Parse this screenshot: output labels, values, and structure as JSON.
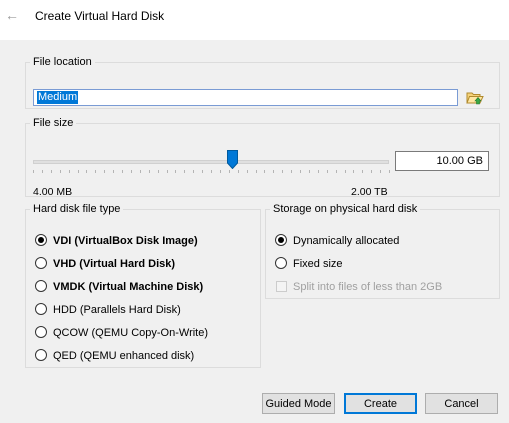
{
  "dialog": {
    "title": "Create Virtual Hard Disk"
  },
  "file_location": {
    "legend": "File location",
    "value": "Medium"
  },
  "file_size": {
    "legend": "File size",
    "value": "10.00 GB",
    "min_label": "4.00 MB",
    "max_label": "2.00 TB",
    "slider_fraction": 0.56
  },
  "disk_type": {
    "legend": "Hard disk file type",
    "options": [
      {
        "label": "VDI (VirtualBox Disk Image)",
        "selected": true
      },
      {
        "label": "VHD (Virtual Hard Disk)",
        "selected": false
      },
      {
        "label": "VMDK (Virtual Machine Disk)",
        "selected": false
      },
      {
        "label": "HDD (Parallels Hard Disk)",
        "selected": false
      },
      {
        "label": "QCOW (QEMU Copy-On-Write)",
        "selected": false
      },
      {
        "label": "QED (QEMU enhanced disk)",
        "selected": false
      }
    ]
  },
  "storage": {
    "legend": "Storage on physical hard disk",
    "options": [
      {
        "label": "Dynamically allocated",
        "selected": true
      },
      {
        "label": "Fixed size",
        "selected": false
      }
    ],
    "split_label": "Split into files of less than 2GB",
    "split_checked": false,
    "split_enabled": false
  },
  "buttons": {
    "guided": "Guided Mode",
    "create": "Create",
    "cancel": "Cancel"
  },
  "colors": {
    "selection": "#0078d7",
    "default_button_border": "#0078d7",
    "thumb": "#0078d7"
  },
  "icons": {
    "back": "back-arrow-icon",
    "folder": "folder-icon"
  }
}
